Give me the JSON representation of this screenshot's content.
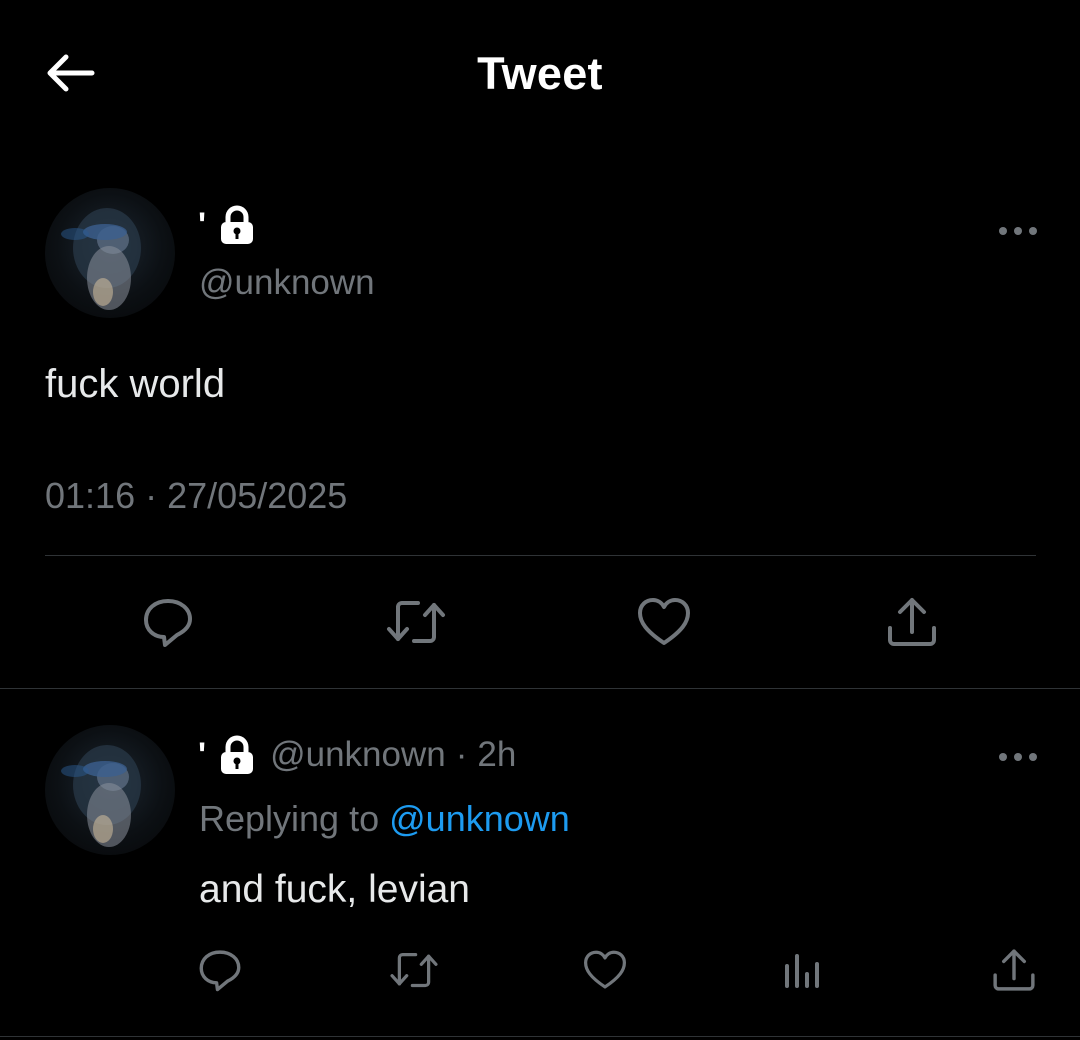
{
  "header": {
    "title": "Tweet",
    "back_icon": "arrow-left-icon"
  },
  "main_tweet": {
    "display_name": "'",
    "protected_icon": "lock-icon",
    "handle": "@unknown",
    "text": "fuck world",
    "time": "01:16",
    "separator": "·",
    "date": "27/05/2025",
    "more_icon": "more-horizontal-icon",
    "actions": [
      "reply-icon",
      "retweet-icon",
      "like-icon",
      "share-icon"
    ]
  },
  "reply_tweet": {
    "display_name": "'",
    "protected_icon": "lock-icon",
    "handle": "@unknown",
    "separator": "·",
    "age": "2h",
    "replying_prefix": "Replying to",
    "replying_to": "@unknown",
    "text": "and fuck, levian",
    "more_icon": "more-horizontal-icon",
    "actions": [
      "reply-icon",
      "retweet-icon",
      "like-icon",
      "analytics-icon",
      "share-icon"
    ]
  },
  "colors": {
    "background": "#000000",
    "text_primary": "#e7e9ea",
    "text_secondary": "#71767b",
    "link": "#1d9bf0",
    "divider": "#2f3336"
  }
}
